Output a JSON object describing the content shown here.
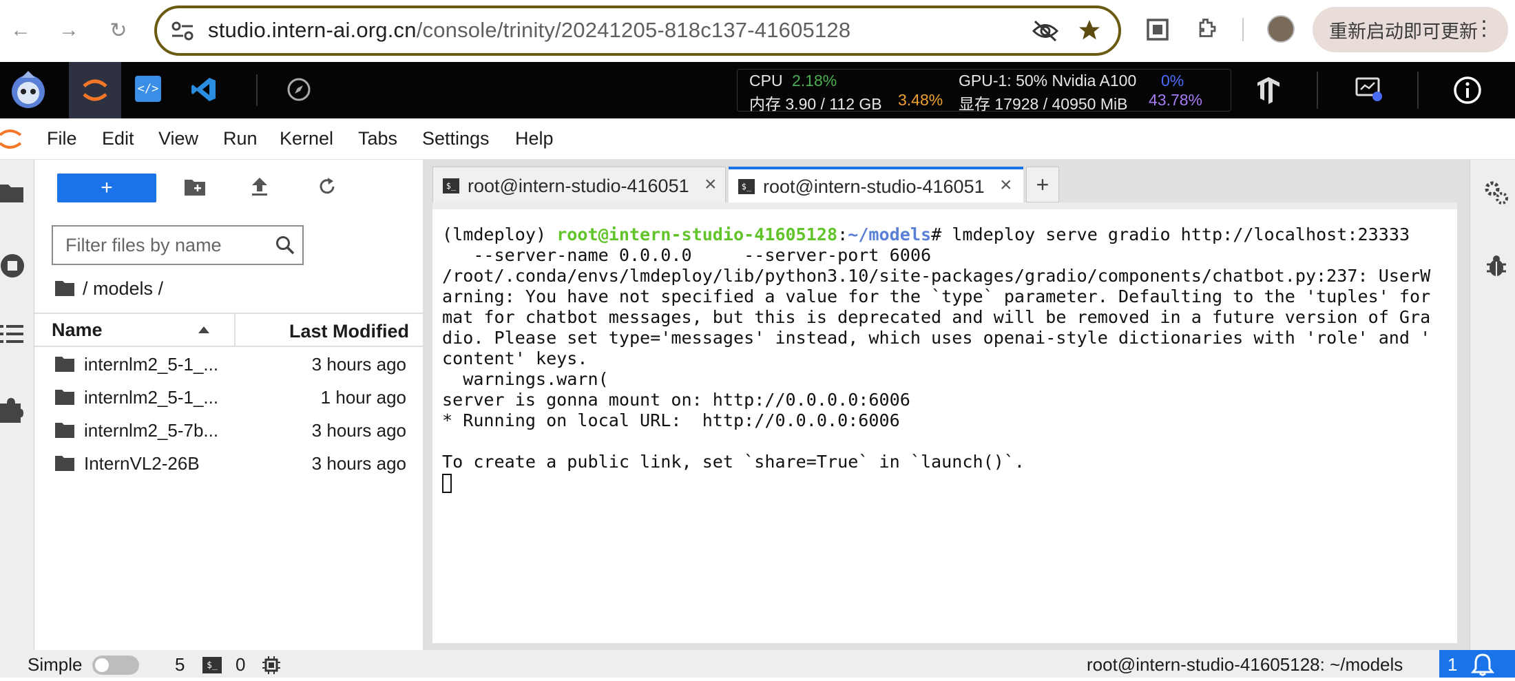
{
  "browser": {
    "url_host": "studio.intern-ai.org.cn",
    "url_path": "/console/trinity/20241205-818c137-41605128",
    "update_label": "重新启动即可更新"
  },
  "studio": {
    "cpu_label": "CPU",
    "cpu_value": "2.18%",
    "mem_label": "内存 3.90 / 112 GB",
    "mem_value": "3.48%",
    "gpu_label": "GPU-1: 50% Nvidia A100",
    "gpu_value": "0%",
    "vram_label": "显存 17928 / 40950 MiB",
    "vram_value": "43.78%"
  },
  "menu": [
    "File",
    "Edit",
    "View",
    "Run",
    "Kernel",
    "Tabs",
    "Settings",
    "Help"
  ],
  "filebrowser": {
    "new_label": "+",
    "filter_placeholder": "Filter files by name",
    "breadcrumb": "/ models /",
    "col_name": "Name",
    "col_modified": "Last Modified",
    "files": [
      {
        "name": "internlm2_5-1_...",
        "modified": "3 hours ago"
      },
      {
        "name": "internlm2_5-1_...",
        "modified": "1 hour ago"
      },
      {
        "name": "internlm2_5-7b...",
        "modified": "3 hours ago"
      },
      {
        "name": "InternVL2-26B",
        "modified": "3 hours ago"
      }
    ]
  },
  "tabs": [
    {
      "label": "root@intern-studio-416051"
    },
    {
      "label": "root@intern-studio-416051"
    }
  ],
  "terminal": {
    "prompt_env": "(lmdeploy) ",
    "prompt_user": "root@intern-studio-41605128",
    "prompt_sep": ":",
    "prompt_path": "~/models",
    "prompt_cmd": "# lmdeploy serve gradio http://localhost:23333",
    "lines": [
      "   --server-name 0.0.0.0     --server-port 6006",
      "/root/.conda/envs/lmdeploy/lib/python3.10/site-packages/gradio/components/chatbot.py:237: UserW",
      "arning: You have not specified a value for the `type` parameter. Defaulting to the 'tuples' for",
      "mat for chatbot messages, but this is deprecated and will be removed in a future version of Gra",
      "dio. Please set type='messages' instead, which uses openai-style dictionaries with 'role' and '",
      "content' keys.",
      "  warnings.warn(",
      "server is gonna mount on: http://0.0.0.0:6006",
      "* Running on local URL:  http://0.0.0.0:6006",
      "",
      "To create a public link, set `share=True` in `launch()`."
    ]
  },
  "status": {
    "simple_label": "Simple",
    "count_a": "5",
    "count_b": "0",
    "right_text": "root@intern-studio-41605128: ~/models",
    "notif_count": "1"
  },
  "colors": {
    "accent_blue": "#1a73e8",
    "cpu_green": "#4caf50",
    "mem_orange": "#f0a030",
    "gpu_blue": "#4a6cf7",
    "vram_purple": "#a77cf5"
  }
}
